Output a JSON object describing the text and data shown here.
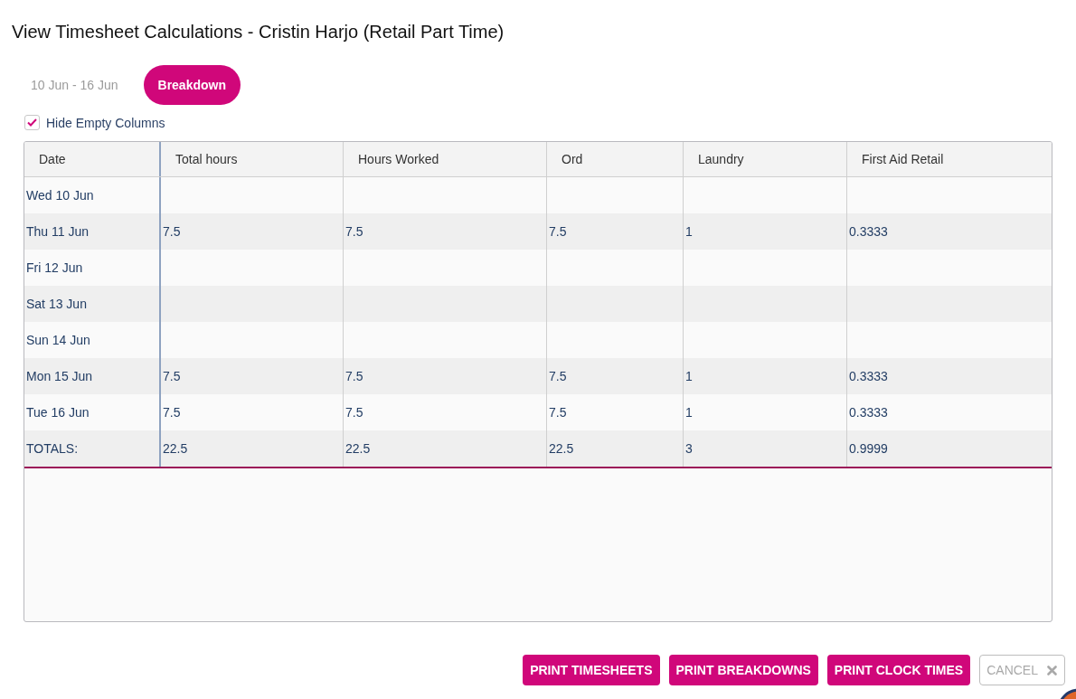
{
  "dialog": {
    "title": "View Timesheet Calculations - Cristin Harjo (Retail Part Time)"
  },
  "tabs": [
    {
      "label": "10 Jun - 16 Jun",
      "selected": false
    },
    {
      "label": "Breakdown",
      "selected": true
    }
  ],
  "hide_empty_columns": {
    "label": "Hide Empty Columns",
    "checked": true
  },
  "table": {
    "columns": [
      "Date",
      "Total hours",
      "Hours Worked",
      "Ord",
      "Laundry",
      "First Aid Retail"
    ],
    "rows": [
      {
        "date": "Wed 10 Jun"
      },
      {
        "date": "Thu 11 Jun",
        "values": [
          "7.5",
          "7.5",
          "7.5",
          "1",
          "0.3333"
        ]
      },
      {
        "date": "Fri 12 Jun"
      },
      {
        "date": "Sat 13 Jun"
      },
      {
        "date": "Sun 14 Jun"
      },
      {
        "date": "Mon 15 Jun",
        "values": [
          "7.5",
          "7.5",
          "7.5",
          "1",
          "0.3333"
        ]
      },
      {
        "date": "Tue 16 Jun",
        "values": [
          "7.5",
          "7.5",
          "7.5",
          "1",
          "0.3333"
        ]
      }
    ],
    "totals": {
      "label": "TOTALS:",
      "values": [
        "22.5",
        "22.5",
        "22.5",
        "3",
        "0.9999"
      ]
    }
  },
  "buttons": [
    {
      "label": "PRINT TIMESHEETS",
      "kind": "primary"
    },
    {
      "label": "PRINT BREAKDOWNS",
      "kind": "primary"
    },
    {
      "label": "PRINT CLOCK TIMES",
      "kind": "primary"
    },
    {
      "label": "CANCEL",
      "kind": "cancel"
    }
  ]
}
